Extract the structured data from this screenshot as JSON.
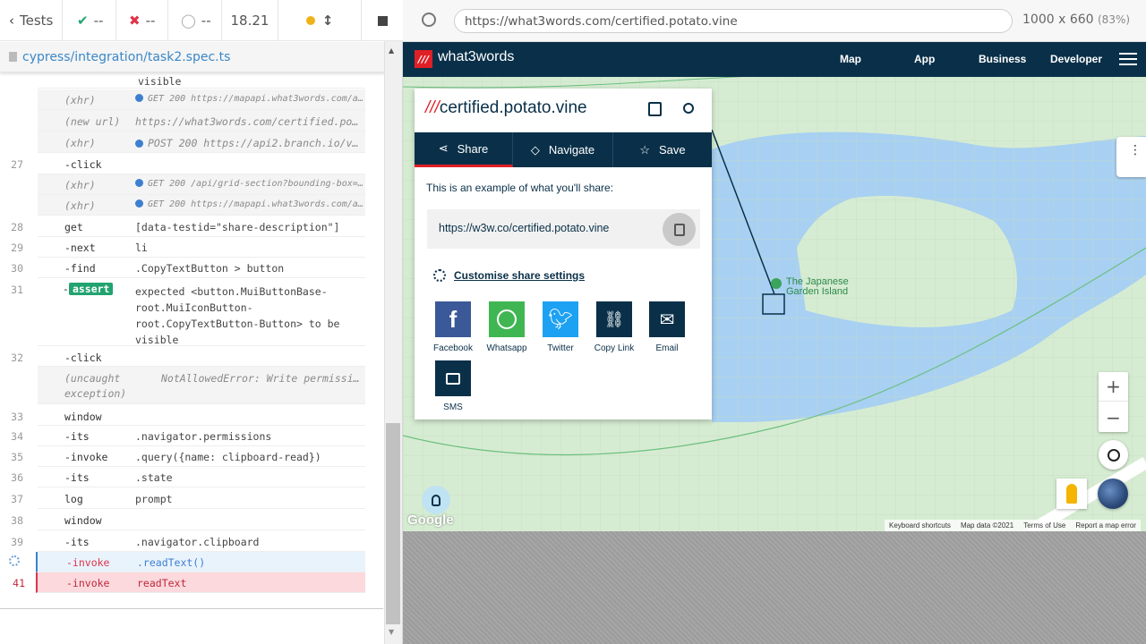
{
  "reporter": {
    "back_label": "Tests",
    "passed": "--",
    "failed": "--",
    "pending": "--",
    "duration": "18.21",
    "spec_path": "cypress/integration/task2.spec.ts"
  },
  "commands": [
    {
      "num": "",
      "name": "",
      "msg": "visible"
    },
    {
      "num": "",
      "name": "(xhr)",
      "msg": "GET 200 https://mapapi.what3words.com/api/..."
    },
    {
      "num": "",
      "name": "(new url)",
      "msg": "https://what3words.com/certified.potato.vine"
    },
    {
      "num": "",
      "name": "(xhr)",
      "msg": "POST 200 https://api2.branch.io/v1/..."
    },
    {
      "num": "27",
      "name": "-click",
      "msg": ""
    },
    {
      "num": "",
      "name": "(xhr)",
      "msg": "GET 200 /api/grid-section?bounding-box=5..."
    },
    {
      "num": "",
      "name": "(xhr)",
      "msg": "GET 200 https://mapapi.what3words.com/api/..."
    },
    {
      "num": "28",
      "name": "get",
      "msg": "[data-testid=\"share-description\"]"
    },
    {
      "num": "29",
      "name": "-next",
      "msg": "li"
    },
    {
      "num": "30",
      "name": "-find",
      "msg": ".CopyTextButton > button"
    },
    {
      "num": "31",
      "name": "assert",
      "msg_lines": [
        "expected <button.MuiButtonBase-",
        "root.MuiIconButton-",
        "root.CopyTextButton-Button> to be",
        "visible"
      ]
    },
    {
      "num": "32",
      "name": "-click",
      "msg": ""
    },
    {
      "num": "",
      "name": "(uncaught exception)",
      "msg": "NotAllowedError: Write permission..."
    },
    {
      "num": "33",
      "name": "window",
      "msg": ""
    },
    {
      "num": "34",
      "name": "-its",
      "msg": ".navigator.permissions"
    },
    {
      "num": "35",
      "name": "-invoke",
      "msg": ".query({name: clipboard-read})"
    },
    {
      "num": "36",
      "name": "-its",
      "msg": ".state"
    },
    {
      "num": "37",
      "name": "log",
      "msg": "prompt"
    },
    {
      "num": "38",
      "name": "window",
      "msg": ""
    },
    {
      "num": "39",
      "name": "-its",
      "msg": ".navigator.clipboard"
    },
    {
      "num": "",
      "name": "-invoke",
      "msg": ".readText()"
    },
    {
      "num": "41",
      "name": "-invoke",
      "msg": "readText"
    }
  ],
  "browser": {
    "url": "https://what3words.com/certified.potato.vine",
    "viewport": "1000 x 660",
    "scale": "(83%)"
  },
  "site": {
    "logo_mark": "///",
    "logo_text": "what3words",
    "nav": [
      "Map",
      "App",
      "Business",
      "Developer"
    ]
  },
  "card": {
    "slashes": "///",
    "address": "certified.potato.vine",
    "tabs": [
      "Share",
      "Navigate",
      "Save"
    ],
    "example": "This is an example of what you'll share:",
    "share_url": "https://w3w.co/certified.potato.vine",
    "customise": "Customise share settings",
    "targets": [
      "Facebook",
      "Whatsapp",
      "Twitter",
      "Copy Link",
      "Email",
      "SMS"
    ]
  },
  "map": {
    "poi_line1": "The Japanese",
    "poi_line2": "Garden Island",
    "google": "Google",
    "attribution": [
      "Keyboard shortcuts",
      "Map data ©2021",
      "Terms of Use",
      "Report a map error"
    ]
  },
  "colors": {
    "brand_red": "#e11f26",
    "brand_navy": "#0a3049",
    "pass_green": "#22a36f",
    "fail_red": "#e0344a"
  }
}
